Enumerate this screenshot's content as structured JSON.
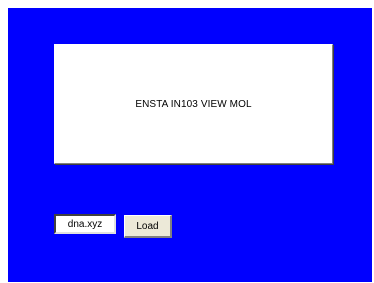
{
  "display": {
    "text": "ENSTA IN103 VIEW MOL"
  },
  "file_input": {
    "value": "dna.xyz"
  },
  "load_button": {
    "label": "Load"
  },
  "colors": {
    "window_background": "#0000ff",
    "panel_background": "#ffffff",
    "button_face": "#ece9d8"
  }
}
